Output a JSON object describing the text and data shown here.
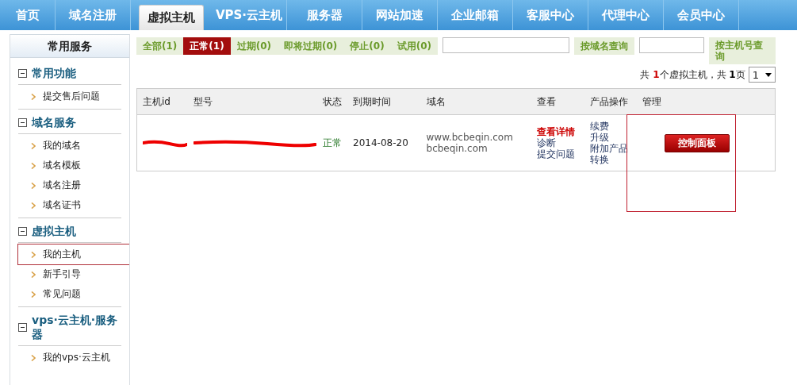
{
  "nav": {
    "tabs": [
      {
        "label": "首页",
        "selected": false
      },
      {
        "label": "域名注册",
        "selected": false
      },
      {
        "label": "虚拟主机",
        "selected": true
      },
      {
        "label": "VPS·云主机",
        "selected": false
      },
      {
        "label": "服务器",
        "selected": false
      },
      {
        "label": "网站加速",
        "selected": false
      },
      {
        "label": "企业邮箱",
        "selected": false
      },
      {
        "label": "客服中心",
        "selected": false
      },
      {
        "label": "代理中心",
        "selected": false
      },
      {
        "label": "会员中心",
        "selected": false
      }
    ]
  },
  "sidebar": {
    "title": "常用服务",
    "groups": [
      {
        "title": "常用功能",
        "expanded": true,
        "items": [
          {
            "label": "提交售后问题",
            "highlighted": false
          }
        ]
      },
      {
        "title": "域名服务",
        "expanded": true,
        "items": [
          {
            "label": "我的域名",
            "highlighted": false
          },
          {
            "label": "域名模板",
            "highlighted": false
          },
          {
            "label": "域名注册",
            "highlighted": false
          },
          {
            "label": "域名证书",
            "highlighted": false
          }
        ]
      },
      {
        "title": "虚拟主机",
        "expanded": true,
        "items": [
          {
            "label": "我的主机",
            "highlighted": true
          },
          {
            "label": "新手引导",
            "highlighted": false
          },
          {
            "label": "常见问题",
            "highlighted": false
          }
        ]
      },
      {
        "title": "vps·云主机·服务器",
        "expanded": true,
        "items": [
          {
            "label": "我的vps·云主机",
            "highlighted": false
          }
        ]
      }
    ]
  },
  "filters": [
    {
      "label": "全部(1)",
      "selected": false
    },
    {
      "label": "正常(1)",
      "selected": true
    },
    {
      "label": "过期(0)",
      "selected": false
    },
    {
      "label": "即将过期(0)",
      "selected": false
    },
    {
      "label": "停止(0)",
      "selected": false
    },
    {
      "label": "试用(0)",
      "selected": false
    }
  ],
  "search": {
    "domain_button": "按域名查询",
    "host_button": "按主机号查询"
  },
  "pagination": {
    "prefix": "共",
    "count": "1",
    "middle": "个虚拟主机，共",
    "pages": "1",
    "suffix": "页",
    "page_select": "1"
  },
  "table": {
    "columns": [
      "主机id",
      "型号",
      "状态",
      "到期时间",
      "域名",
      "查看",
      "产品操作",
      "管理"
    ],
    "rows": [
      {
        "id_redacted": true,
        "model_redacted": true,
        "status": "正常",
        "expires": "2014-08-20",
        "domains": [
          "www.bcbeqin.com",
          "bcbeqin.com"
        ],
        "view_links": [
          "查看详情",
          "诊断",
          "提交问题"
        ],
        "actions": [
          "续费",
          "升级",
          "附加产品",
          "转换"
        ],
        "manage_button": "控制面板",
        "manage_highlighted": true
      }
    ]
  }
}
